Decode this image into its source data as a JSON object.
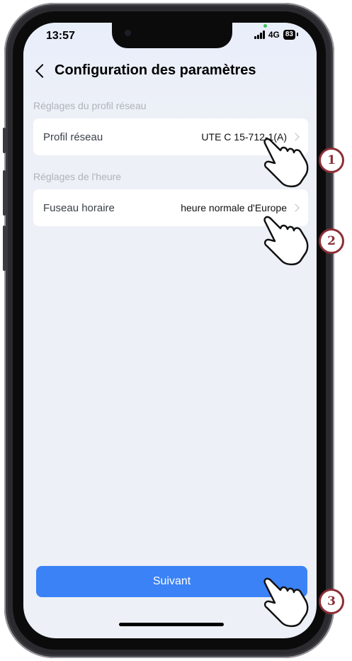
{
  "status_bar": {
    "time": "13:57",
    "network": "4G",
    "battery": "83"
  },
  "header": {
    "title": "Configuration des paramètres",
    "back_icon": "chevron-left-icon"
  },
  "sections": [
    {
      "label": "Réglages du profil réseau",
      "row": {
        "label": "Profil réseau",
        "value": "UTE C 15-712-1(A)"
      }
    },
    {
      "label": "Réglages de l'heure",
      "row": {
        "label": "Fuseau horaire",
        "value": "heure normale d'Europe"
      }
    }
  ],
  "footer": {
    "next_label": "Suivant"
  },
  "annotations": {
    "step1": "1",
    "step2": "2",
    "step3": "3",
    "accent_color": "#8b2f36"
  },
  "colors": {
    "primary": "#3b82f6",
    "background": "#edf0f6"
  }
}
